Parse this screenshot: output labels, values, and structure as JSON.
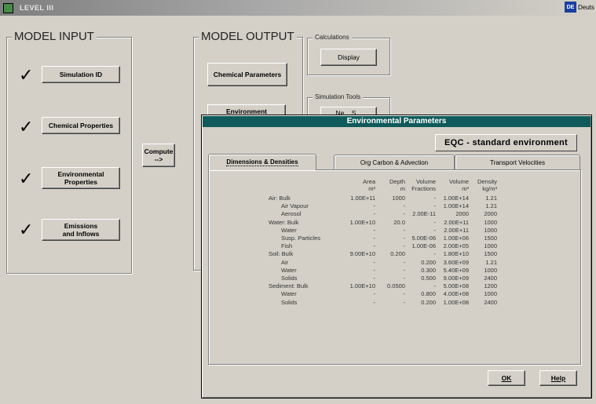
{
  "window": {
    "title": "LEVEL III",
    "lang_flag": "DE",
    "lang_label": "Deuts"
  },
  "model_input": {
    "title": "MODEL INPUT",
    "items": [
      {
        "label": "Simulation ID",
        "checked": true
      },
      {
        "label": "Chemical Properties",
        "checked": true
      },
      {
        "label": "Environmental Properties",
        "checked": true
      },
      {
        "label": "Emissions and Inflows",
        "checked": true
      }
    ],
    "check_glyph": "✓"
  },
  "compute": {
    "label": "Compute -->"
  },
  "model_output": {
    "title": "MODEL OUTPUT",
    "chemical_parameters": "Chemical Parameters",
    "environment": "Environment"
  },
  "calculations": {
    "title": "Calculations",
    "display": "Display"
  },
  "simulation_tools": {
    "title": "Simulation Tools",
    "partial_button": "Ne... S..."
  },
  "dialog": {
    "title": "Environmental Parameters",
    "environment_name": "EQC - standard environment",
    "tabs": [
      {
        "label": "Dimensions & Densities",
        "active": true
      },
      {
        "label": "Org Carbon & Advection",
        "active": false
      },
      {
        "label": "Transport Velocities",
        "active": false
      }
    ],
    "columns": [
      {
        "line1": "Area",
        "line2": "m²"
      },
      {
        "line1": "Depth",
        "line2": "m"
      },
      {
        "line1": "Volume",
        "line2": "Fractions"
      },
      {
        "line1": "Volume",
        "line2": "m³"
      },
      {
        "line1": "Density",
        "line2": "kg/m³"
      }
    ],
    "rows": [
      {
        "label": "Air: Bulk",
        "indent": false,
        "values": [
          "1.00E+11",
          "1000",
          "-",
          "1.00E+14",
          "1.21"
        ]
      },
      {
        "label": "Air Vapour",
        "indent": true,
        "values": [
          "-",
          "-",
          "-",
          "1.00E+14",
          "1.21"
        ]
      },
      {
        "label": "Aerosol",
        "indent": true,
        "values": [
          "-",
          "-",
          "2.00E-11",
          "2000",
          "2000"
        ]
      },
      {
        "label": "Water: Bulk",
        "indent": false,
        "values": [
          "1.00E+10",
          "20.0",
          "-",
          "2.00E+11",
          "1000"
        ]
      },
      {
        "label": "Water",
        "indent": true,
        "values": [
          "-",
          "-",
          "-",
          "2.00E+11",
          "1000"
        ]
      },
      {
        "label": "Susp. Particles",
        "indent": true,
        "values": [
          "-",
          "-",
          "5.00E-06",
          "1.00E+06",
          "1500"
        ]
      },
      {
        "label": "Fish",
        "indent": true,
        "values": [
          "-",
          "-",
          "1.00E-06",
          "2.00E+05",
          "1000"
        ]
      },
      {
        "label": "Soil: Bulk",
        "indent": false,
        "values": [
          "9.00E+10",
          "0.200",
          "-",
          "1.80E+10",
          "1500"
        ]
      },
      {
        "label": "Air",
        "indent": true,
        "values": [
          "-",
          "-",
          "0.200",
          "3.60E+09",
          "1.21"
        ]
      },
      {
        "label": "Water",
        "indent": true,
        "values": [
          "-",
          "-",
          "0.300",
          "5.40E+09",
          "1000"
        ]
      },
      {
        "label": "Solids",
        "indent": true,
        "values": [
          "-",
          "-",
          "0.500",
          "9.00E+09",
          "2400"
        ]
      },
      {
        "label": "Sediment: Bulk",
        "indent": false,
        "values": [
          "1.00E+10",
          "0.0500",
          "-",
          "5.00E+08",
          "1200"
        ]
      },
      {
        "label": "Water",
        "indent": true,
        "values": [
          "-",
          "-",
          "0.800",
          "4.00E+08",
          "1000"
        ]
      },
      {
        "label": "Solids",
        "indent": true,
        "values": [
          "-",
          "-",
          "0.200",
          "1.00E+08",
          "2400"
        ]
      }
    ],
    "ok_label": "OK",
    "help_label": "Help"
  }
}
